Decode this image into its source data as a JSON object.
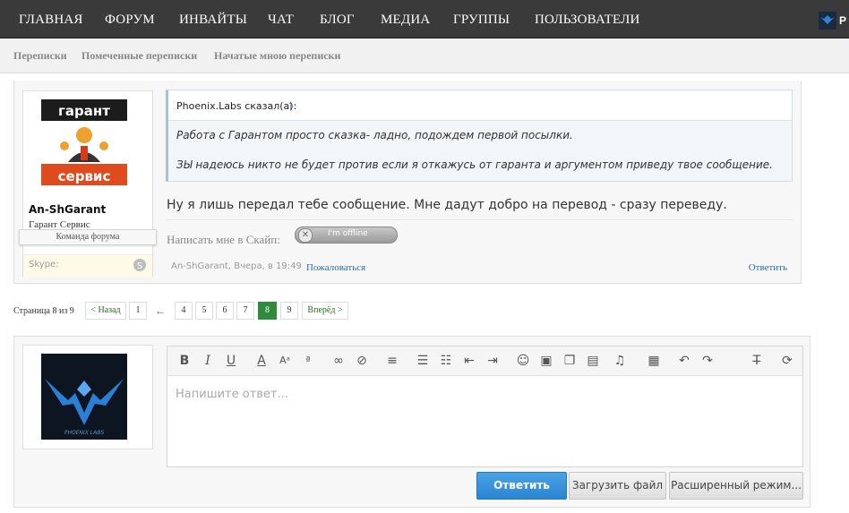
{
  "topnav": {
    "items": [
      "ГЛАВНАЯ",
      "ФОРУМ",
      "ИНВАЙТЫ",
      "ЧАТ",
      "БЛОГ",
      "МЕДИА",
      "ГРУППЫ",
      "ПОЛЬЗОВАТЕЛИ"
    ],
    "corner_letter": "P"
  },
  "subnav": {
    "items": [
      "Переписки",
      "Помеченные переписки",
      "Начатые мною переписки"
    ]
  },
  "post": {
    "username": "An-ShGarant",
    "user_title": "Гарант Сервис",
    "badge": "Команда форума",
    "avatar_top": "гарант",
    "avatar_bottom": "сервис",
    "skype_label": "Skype:",
    "quote": {
      "author": "Phoenix.Labs сказал(а):",
      "arrow": "↑",
      "line1": "Работа с Гарантом просто сказка- ладно, подождем первой посылки.",
      "line2": "ЗЫ надеюсь никто не будет против если я откажусь от гаранта и аргументом приведу твое сообщение."
    },
    "message": "Ну я лишь передал тебе сообщение. Мне дадут добро на перевод - сразу переведу.",
    "signature": "Написать мне в Скайп:",
    "skype_status": "I'm offline",
    "meta": "An-ShGarant, Вчера, в 19:49",
    "report_label": "Пожаловаться",
    "reply_label": "Ответить"
  },
  "pagination": {
    "label": "Страница 8 из 9",
    "prev": "< Назад",
    "ellipsis": "←",
    "pages": [
      "1",
      "4",
      "5",
      "6",
      "7",
      "8",
      "9"
    ],
    "current": "8",
    "next": "Вперёд >"
  },
  "reply": {
    "placeholder": "Напишите ответ...",
    "avatar_caption": "PHOENIX LABS",
    "submit": "Ответить",
    "upload": "Загрузить файл",
    "advanced": "Расширенный режим..."
  },
  "colors": {
    "topbar": "#3a3a3a",
    "accent_blue": "#2b84cf",
    "current_page": "#2e8b3a",
    "link": "#2a6fa3"
  }
}
